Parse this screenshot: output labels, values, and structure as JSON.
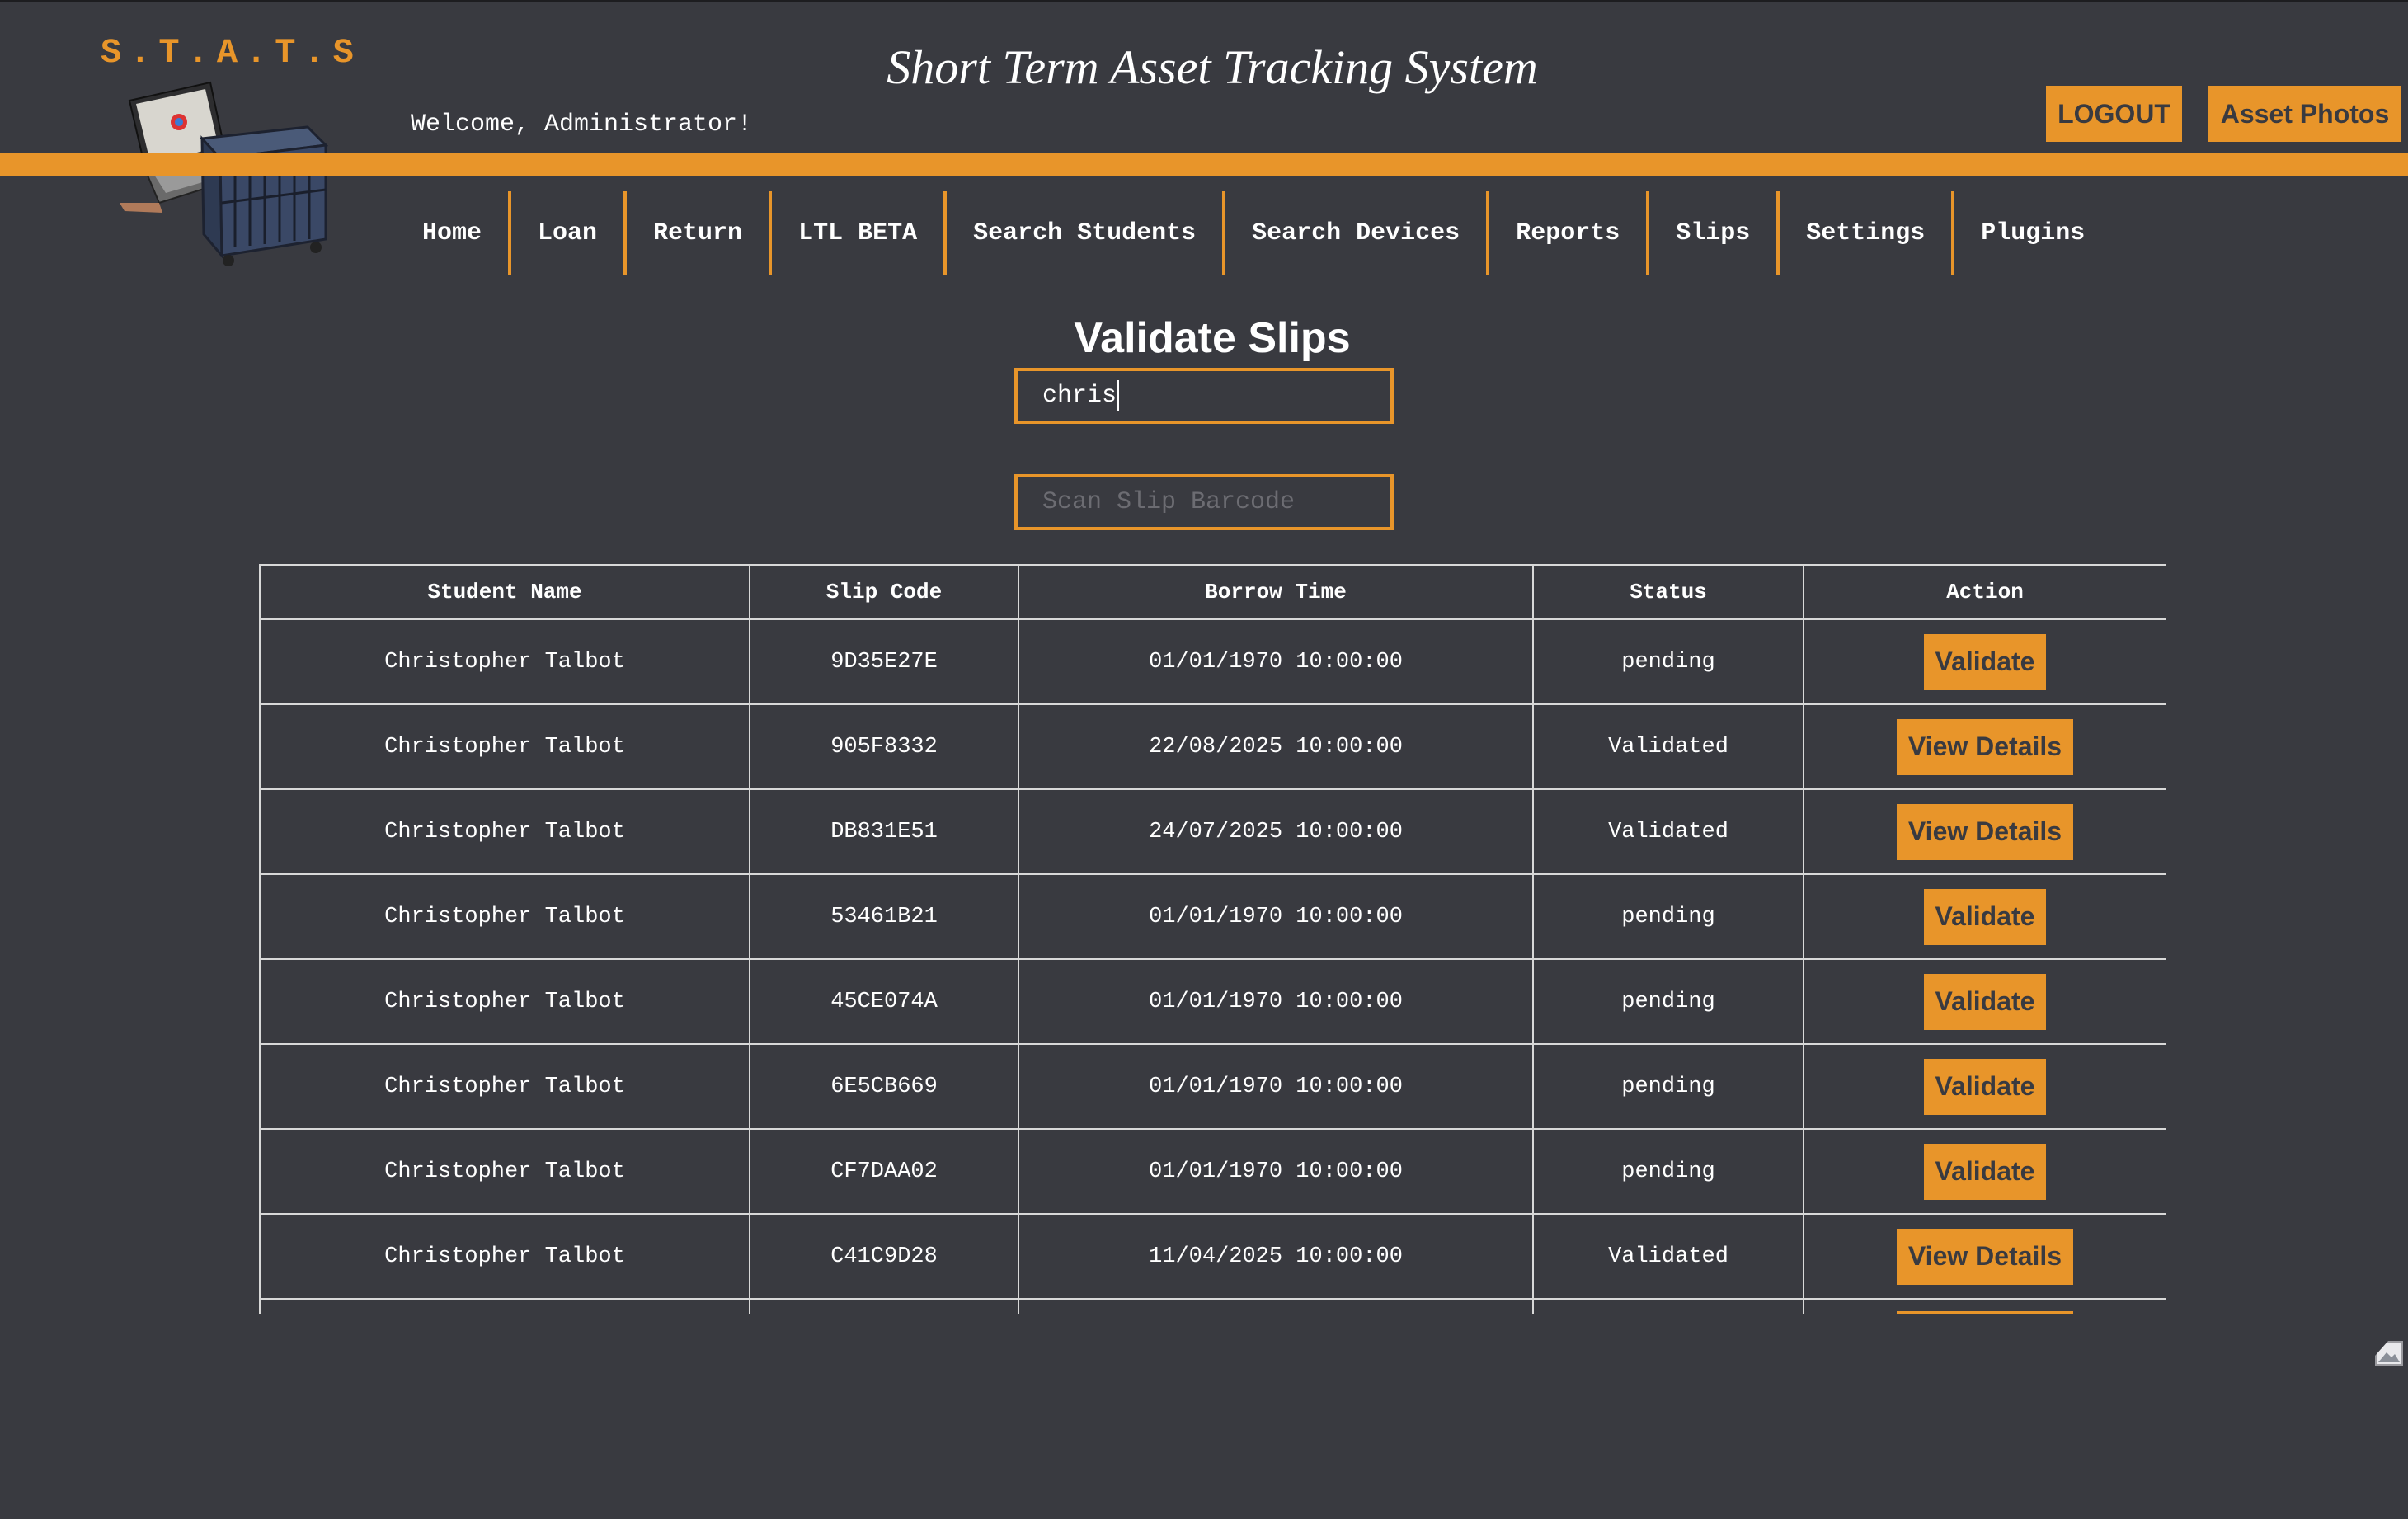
{
  "header": {
    "logo_text": "S.T.A.T.S",
    "title": "Short Term Asset Tracking System",
    "welcome": "Welcome, Administrator!",
    "logout_label": "LOGOUT",
    "asset_photos_label": "Asset Photos"
  },
  "nav": {
    "items": [
      {
        "label": "Home"
      },
      {
        "label": "Loan"
      },
      {
        "label": "Return"
      },
      {
        "label": "LTL BETA"
      },
      {
        "label": "Search Students"
      },
      {
        "label": "Search Devices"
      },
      {
        "label": "Reports"
      },
      {
        "label": "Slips"
      },
      {
        "label": "Settings"
      },
      {
        "label": "Plugins"
      }
    ]
  },
  "main": {
    "heading": "Validate Slips",
    "search_value": "chris",
    "barcode_placeholder": "Scan Slip Barcode",
    "table": {
      "columns": [
        "Student Name",
        "Slip Code",
        "Borrow Time",
        "Status",
        "Action"
      ],
      "rows": [
        {
          "student": "Christopher Talbot",
          "code": "9D35E27E",
          "time": "01/01/1970 10:00:00",
          "status": "pending",
          "action": "Validate"
        },
        {
          "student": "Christopher Talbot",
          "code": "905F8332",
          "time": "22/08/2025 10:00:00",
          "status": "Validated",
          "action": "View Details"
        },
        {
          "student": "Christopher Talbot",
          "code": "DB831E51",
          "time": "24/07/2025 10:00:00",
          "status": "Validated",
          "action": "View Details"
        },
        {
          "student": "Christopher Talbot",
          "code": "53461B21",
          "time": "01/01/1970 10:00:00",
          "status": "pending",
          "action": "Validate"
        },
        {
          "student": "Christopher Talbot",
          "code": "45CE074A",
          "time": "01/01/1970 10:00:00",
          "status": "pending",
          "action": "Validate"
        },
        {
          "student": "Christopher Talbot",
          "code": "6E5CB669",
          "time": "01/01/1970 10:00:00",
          "status": "pending",
          "action": "Validate"
        },
        {
          "student": "Christopher Talbot",
          "code": "CF7DAA02",
          "time": "01/01/1970 10:00:00",
          "status": "pending",
          "action": "Validate"
        },
        {
          "student": "Christopher Talbot",
          "code": "C41C9D28",
          "time": "11/04/2025 10:00:00",
          "status": "Validated",
          "action": "View Details"
        }
      ]
    }
  },
  "colors": {
    "accent": "#e8952a",
    "background": "#393a40",
    "text": "#ffffff"
  },
  "icons": {
    "logo": "laptop-cart-icon",
    "broken_image": "broken-image-icon"
  }
}
